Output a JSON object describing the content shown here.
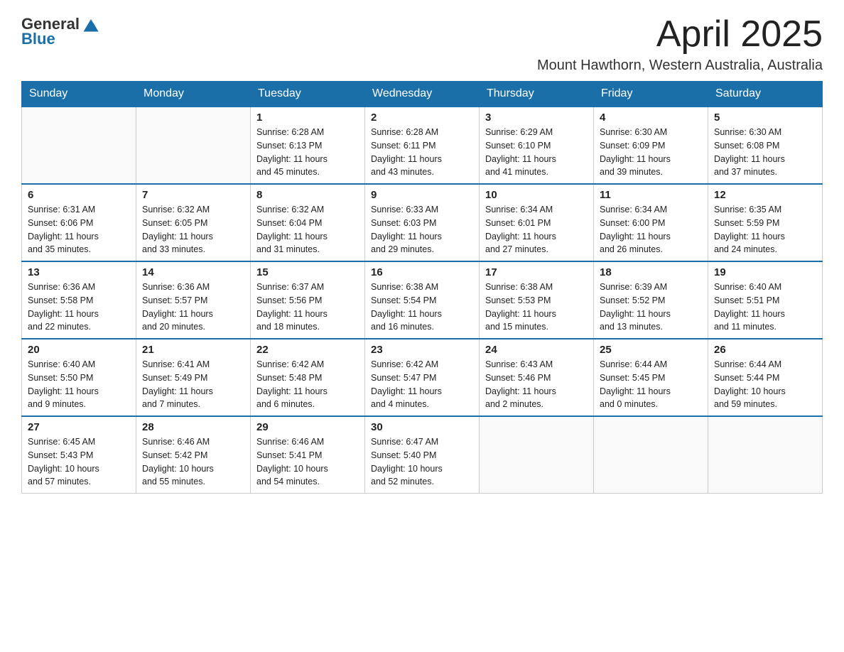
{
  "logo": {
    "general": "General",
    "blue": "Blue"
  },
  "header": {
    "month": "April 2025",
    "location": "Mount Hawthorn, Western Australia, Australia"
  },
  "days_of_week": [
    "Sunday",
    "Monday",
    "Tuesday",
    "Wednesday",
    "Thursday",
    "Friday",
    "Saturday"
  ],
  "weeks": [
    [
      {
        "day": "",
        "info": ""
      },
      {
        "day": "",
        "info": ""
      },
      {
        "day": "1",
        "info": "Sunrise: 6:28 AM\nSunset: 6:13 PM\nDaylight: 11 hours\nand 45 minutes."
      },
      {
        "day": "2",
        "info": "Sunrise: 6:28 AM\nSunset: 6:11 PM\nDaylight: 11 hours\nand 43 minutes."
      },
      {
        "day": "3",
        "info": "Sunrise: 6:29 AM\nSunset: 6:10 PM\nDaylight: 11 hours\nand 41 minutes."
      },
      {
        "day": "4",
        "info": "Sunrise: 6:30 AM\nSunset: 6:09 PM\nDaylight: 11 hours\nand 39 minutes."
      },
      {
        "day": "5",
        "info": "Sunrise: 6:30 AM\nSunset: 6:08 PM\nDaylight: 11 hours\nand 37 minutes."
      }
    ],
    [
      {
        "day": "6",
        "info": "Sunrise: 6:31 AM\nSunset: 6:06 PM\nDaylight: 11 hours\nand 35 minutes."
      },
      {
        "day": "7",
        "info": "Sunrise: 6:32 AM\nSunset: 6:05 PM\nDaylight: 11 hours\nand 33 minutes."
      },
      {
        "day": "8",
        "info": "Sunrise: 6:32 AM\nSunset: 6:04 PM\nDaylight: 11 hours\nand 31 minutes."
      },
      {
        "day": "9",
        "info": "Sunrise: 6:33 AM\nSunset: 6:03 PM\nDaylight: 11 hours\nand 29 minutes."
      },
      {
        "day": "10",
        "info": "Sunrise: 6:34 AM\nSunset: 6:01 PM\nDaylight: 11 hours\nand 27 minutes."
      },
      {
        "day": "11",
        "info": "Sunrise: 6:34 AM\nSunset: 6:00 PM\nDaylight: 11 hours\nand 26 minutes."
      },
      {
        "day": "12",
        "info": "Sunrise: 6:35 AM\nSunset: 5:59 PM\nDaylight: 11 hours\nand 24 minutes."
      }
    ],
    [
      {
        "day": "13",
        "info": "Sunrise: 6:36 AM\nSunset: 5:58 PM\nDaylight: 11 hours\nand 22 minutes."
      },
      {
        "day": "14",
        "info": "Sunrise: 6:36 AM\nSunset: 5:57 PM\nDaylight: 11 hours\nand 20 minutes."
      },
      {
        "day": "15",
        "info": "Sunrise: 6:37 AM\nSunset: 5:56 PM\nDaylight: 11 hours\nand 18 minutes."
      },
      {
        "day": "16",
        "info": "Sunrise: 6:38 AM\nSunset: 5:54 PM\nDaylight: 11 hours\nand 16 minutes."
      },
      {
        "day": "17",
        "info": "Sunrise: 6:38 AM\nSunset: 5:53 PM\nDaylight: 11 hours\nand 15 minutes."
      },
      {
        "day": "18",
        "info": "Sunrise: 6:39 AM\nSunset: 5:52 PM\nDaylight: 11 hours\nand 13 minutes."
      },
      {
        "day": "19",
        "info": "Sunrise: 6:40 AM\nSunset: 5:51 PM\nDaylight: 11 hours\nand 11 minutes."
      }
    ],
    [
      {
        "day": "20",
        "info": "Sunrise: 6:40 AM\nSunset: 5:50 PM\nDaylight: 11 hours\nand 9 minutes."
      },
      {
        "day": "21",
        "info": "Sunrise: 6:41 AM\nSunset: 5:49 PM\nDaylight: 11 hours\nand 7 minutes."
      },
      {
        "day": "22",
        "info": "Sunrise: 6:42 AM\nSunset: 5:48 PM\nDaylight: 11 hours\nand 6 minutes."
      },
      {
        "day": "23",
        "info": "Sunrise: 6:42 AM\nSunset: 5:47 PM\nDaylight: 11 hours\nand 4 minutes."
      },
      {
        "day": "24",
        "info": "Sunrise: 6:43 AM\nSunset: 5:46 PM\nDaylight: 11 hours\nand 2 minutes."
      },
      {
        "day": "25",
        "info": "Sunrise: 6:44 AM\nSunset: 5:45 PM\nDaylight: 11 hours\nand 0 minutes."
      },
      {
        "day": "26",
        "info": "Sunrise: 6:44 AM\nSunset: 5:44 PM\nDaylight: 10 hours\nand 59 minutes."
      }
    ],
    [
      {
        "day": "27",
        "info": "Sunrise: 6:45 AM\nSunset: 5:43 PM\nDaylight: 10 hours\nand 57 minutes."
      },
      {
        "day": "28",
        "info": "Sunrise: 6:46 AM\nSunset: 5:42 PM\nDaylight: 10 hours\nand 55 minutes."
      },
      {
        "day": "29",
        "info": "Sunrise: 6:46 AM\nSunset: 5:41 PM\nDaylight: 10 hours\nand 54 minutes."
      },
      {
        "day": "30",
        "info": "Sunrise: 6:47 AM\nSunset: 5:40 PM\nDaylight: 10 hours\nand 52 minutes."
      },
      {
        "day": "",
        "info": ""
      },
      {
        "day": "",
        "info": ""
      },
      {
        "day": "",
        "info": ""
      }
    ]
  ]
}
